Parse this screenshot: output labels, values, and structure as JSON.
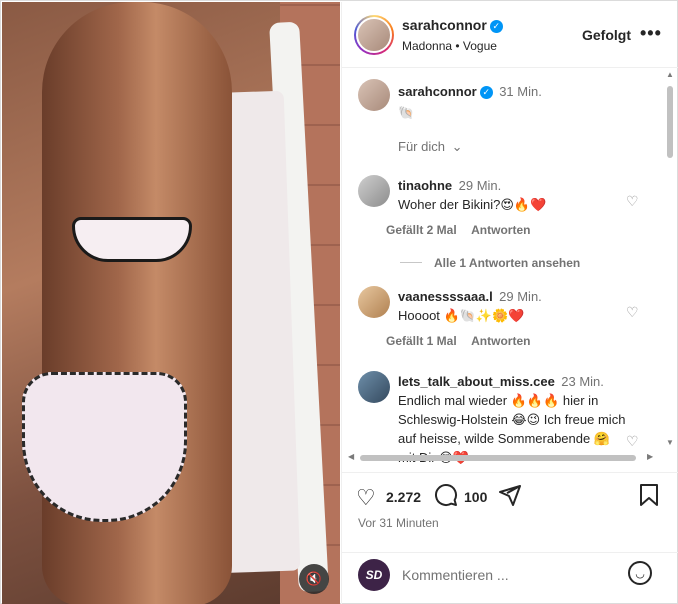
{
  "post": {
    "author": "sarahconnor",
    "subtitle": "Madonna • Vogue",
    "follow_label": "Gefolgt",
    "more_label": "•••",
    "mute_label": "🔇"
  },
  "caption": {
    "user": "sarahconnor",
    "time": "31 Min.",
    "text": "🐚"
  },
  "for_you_label": "Für dich",
  "comments": [
    {
      "user": "tinaohne",
      "time": "29 Min.",
      "text": "Woher der Bikini?😍🔥❤️",
      "likes": "Gefällt 2 Mal",
      "reply": "Antworten"
    },
    {
      "user": "vaanessssaaa.l",
      "time": "29 Min.",
      "text": "Hoooot 🔥🐚✨🌼❤️",
      "likes": "Gefällt 1 Mal",
      "reply": "Antworten"
    },
    {
      "user": "lets_talk_about_miss.cee",
      "time": "23 Min.",
      "text": "Endlich mal wieder 🔥🔥🔥 hier in Schleswig-Holstein 😂😉 Ich freue mich auf heisse, wilde Sommerabende 🤗 mit Dir 😍❤️"
    }
  ],
  "replies_label": "Alle 1 Antworten ansehen",
  "stats": {
    "likes": "2.272",
    "comments": "100",
    "ago": "Vor 31 Minuten"
  },
  "composer": {
    "placeholder": "Kommentieren ...",
    "avatar_text": "SD"
  },
  "colors": {
    "verified": "#0095f6",
    "text": "#262626",
    "muted": "#737373"
  }
}
